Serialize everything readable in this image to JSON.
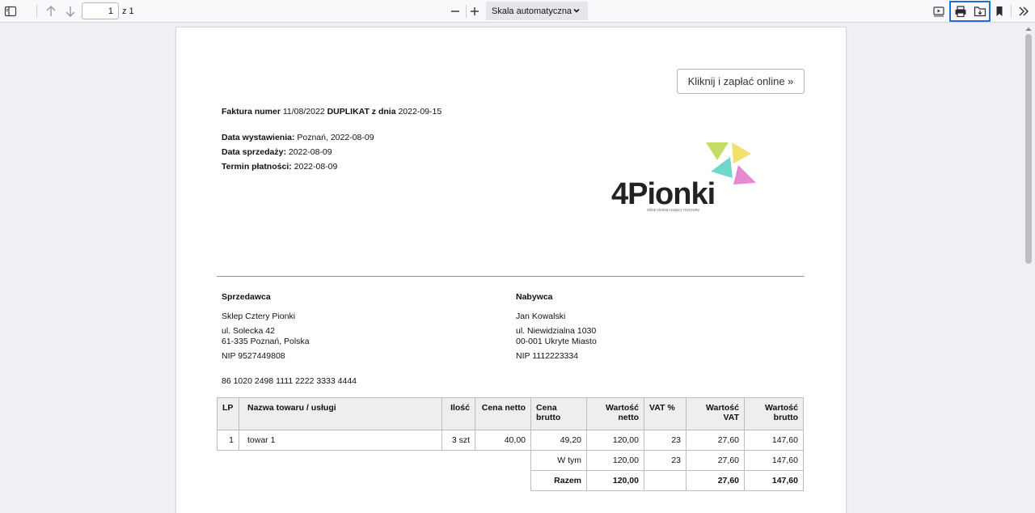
{
  "toolbar": {
    "page_number": "1",
    "page_of": "z 1",
    "zoom_label": "Skala automatyczna"
  },
  "invoice": {
    "pay_button": "Kliknij i zapłać online »",
    "number_label": "Faktura numer",
    "number_value": "11/08/2022",
    "duplicate_label": "DUPLIKAT z dnia",
    "duplicate_date": "2022-09-15",
    "issue_label": "Data wystawienia:",
    "issue_value": "Poznań, 2022-08-09",
    "sale_label": "Data sprzedaży:",
    "sale_value": "2022-08-09",
    "due_label": "Termin płatności:",
    "due_value": "2022-08-09",
    "logo_text": "4Pionki",
    "logo_tagline": "sklep dostarczający rozrywkę",
    "seller": {
      "heading": "Sprzedawca",
      "name": "Sklep Cztery Pionki",
      "street": "ul. Solecka 42",
      "city": "61-335 Poznań, Polska",
      "nip": "NIP 9527449808"
    },
    "buyer": {
      "heading": "Nabywca",
      "name": "Jan Kowalski",
      "street": "ul. Niewidzialna 1030",
      "city": "00-001 Ukryte Miasto",
      "nip": "NIP 1112223334"
    },
    "bank_account": "86 1020 2498 1111 2222 3333 4444",
    "table": {
      "headers": [
        "LP",
        "Nazwa towaru / usługi",
        "Ilość",
        "Cena netto",
        "Cena brutto",
        "Wartość netto",
        "VAT %",
        "Wartość VAT",
        "Wartość brutto"
      ],
      "rows": [
        [
          "1",
          "towar 1",
          "3 szt",
          "40,00",
          "49,20",
          "120,00",
          "23",
          "27,60",
          "147,60"
        ]
      ],
      "summary_wtym": [
        "W tym",
        "120,00",
        "23",
        "27,60",
        "147,60"
      ],
      "summary_razem": [
        "Razem",
        "120,00",
        "",
        "27,60",
        "147,60"
      ]
    }
  },
  "colors": {
    "highlight": "#1b6fdc",
    "logo_yellow": "#f2e06b",
    "logo_green": "#c5de6a",
    "logo_teal": "#6fd7cc",
    "logo_pink": "#e58ad0"
  }
}
